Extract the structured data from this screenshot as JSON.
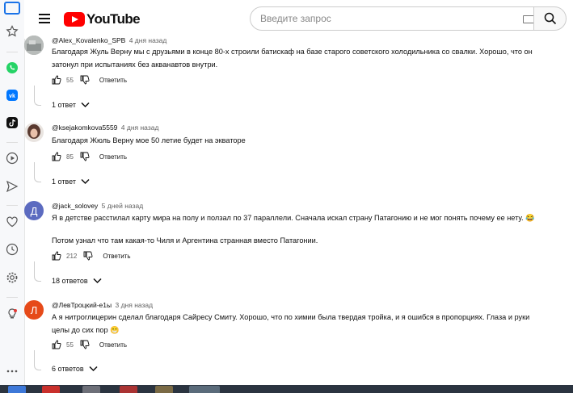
{
  "header": {
    "logo_text": "YouTube",
    "search_placeholder": "Введите запрос"
  },
  "comments": [
    {
      "author": "@Alex_Kovalenko_SPB",
      "date": "4 дня назад",
      "text": "Благодаря Жуль Верну мы с друзьями в конце 80-х строили батискаф на базе старого советского холодильника со свалки. Хорошо, что он затонул при испытаниях без акванавтов внутри.",
      "likes": "55",
      "reply_label": "Ответить",
      "replies_label": "1 ответ",
      "avatar_letter": "",
      "avatar_color": "#a0a4a6"
    },
    {
      "author": "@ksejakomkova5559",
      "date": "4 дня назад",
      "text": "Благодаря Жюль Верну мое 50 летие будет на экваторе",
      "likes": "85",
      "reply_label": "Ответить",
      "replies_label": "1 ответ",
      "avatar_letter": "",
      "avatar_color": "#7a5448"
    },
    {
      "author": "@jack_solovey",
      "date": "5 дней назад",
      "text": "Я в детстве расстилал карту мира на полу и ползал по 37 параллели. Сначала искал страну Патагонию и не мог понять почему ее нету. 😂",
      "text2": "Потом узнал что там какая-то Чиля и Аргентина странная вместо Патагонии.",
      "likes": "212",
      "reply_label": "Ответить",
      "replies_label": "18 ответов",
      "avatar_letter": "Д",
      "avatar_color": "#5c6bc0"
    },
    {
      "author": "@ЛевТроцкий-е1ы",
      "date": "3 дня назад",
      "text": "А я нитроглицерин сделал благодаря Сайресу Смиту. Хорошо, что по химии была твердая тройка, и я ошибся в пропорциях. Глаза и руки целы до сих пор 😁",
      "likes": "55",
      "reply_label": "Ответить",
      "replies_label": "6 ответов",
      "avatar_letter": "Л",
      "avatar_color": "#e64a19"
    }
  ],
  "rail_icons": [
    "home-icon",
    "star-icon",
    "whatsapp-icon",
    "vk-icon",
    "tiktok-icon",
    "play-icon",
    "send-icon",
    "heart-icon",
    "clock-icon",
    "gear-icon",
    "bulb-icon",
    "more-icon"
  ]
}
